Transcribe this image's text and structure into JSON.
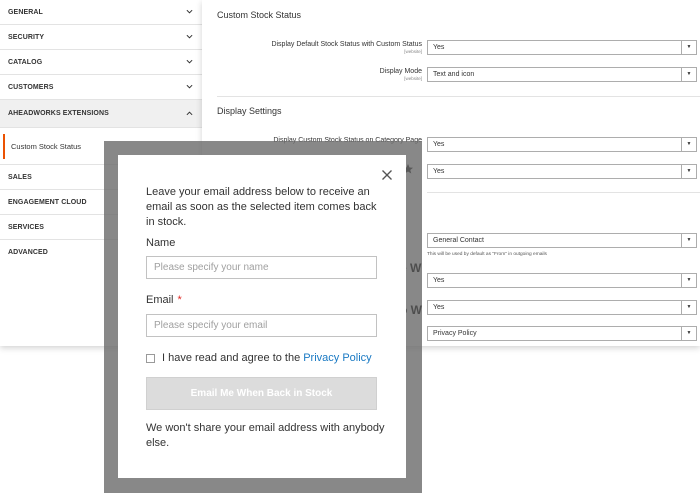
{
  "sidebar": {
    "items": [
      {
        "label": "GENERAL"
      },
      {
        "label": "SECURITY"
      },
      {
        "label": "CATALOG"
      },
      {
        "label": "CUSTOMERS"
      },
      {
        "label": "AHEADWORKS EXTENSIONS"
      }
    ],
    "sub_item": "Custom Stock Status",
    "items_after": [
      {
        "label": "SALES"
      },
      {
        "label": "ENGAGEMENT CLOUD"
      },
      {
        "label": "SERVICES"
      },
      {
        "label": "ADVANCED"
      }
    ]
  },
  "main": {
    "section1_title": "Custom Stock Status",
    "row1": {
      "label": "Display Default Stock Status with Custom Status",
      "scope": "[website]",
      "value": "Yes"
    },
    "row2": {
      "label": "Display Mode",
      "scope": "[website]",
      "value": "Text and icon"
    },
    "section2_title": "Display Settings",
    "row3": {
      "label": "Display Custom Stock Status on Category Page",
      "value": "Yes"
    },
    "row4": {
      "value": "Yes"
    },
    "row5": {
      "value": "General Contact",
      "hint": "This will be used by default as \"From\" in outgoing emails"
    },
    "row6": {
      "value": "Yes"
    },
    "row7": {
      "value": "Yes"
    },
    "row8": {
      "value": "Privacy Policy"
    }
  },
  "overlay": {
    "ghost1": "e W",
    "ghost2": "o W"
  },
  "modal": {
    "intro": "Leave your email address below to receive an email as soon as the selected item comes back in stock.",
    "name_label": "Name",
    "name_placeholder": "Please specify your name",
    "email_label": "Email",
    "email_required": "*",
    "email_placeholder": "Please specify your email",
    "agree_text": "I have read and agree to the",
    "agree_link": "Privacy Policy",
    "submit_label": "Email Me When Back in Stock",
    "footnote": "We won't share your email address with anybody else."
  },
  "colors": {
    "accent": "#eb5202",
    "link": "#1979c3",
    "required": "#e02b27",
    "button_disabled": "#dcdcdc"
  }
}
